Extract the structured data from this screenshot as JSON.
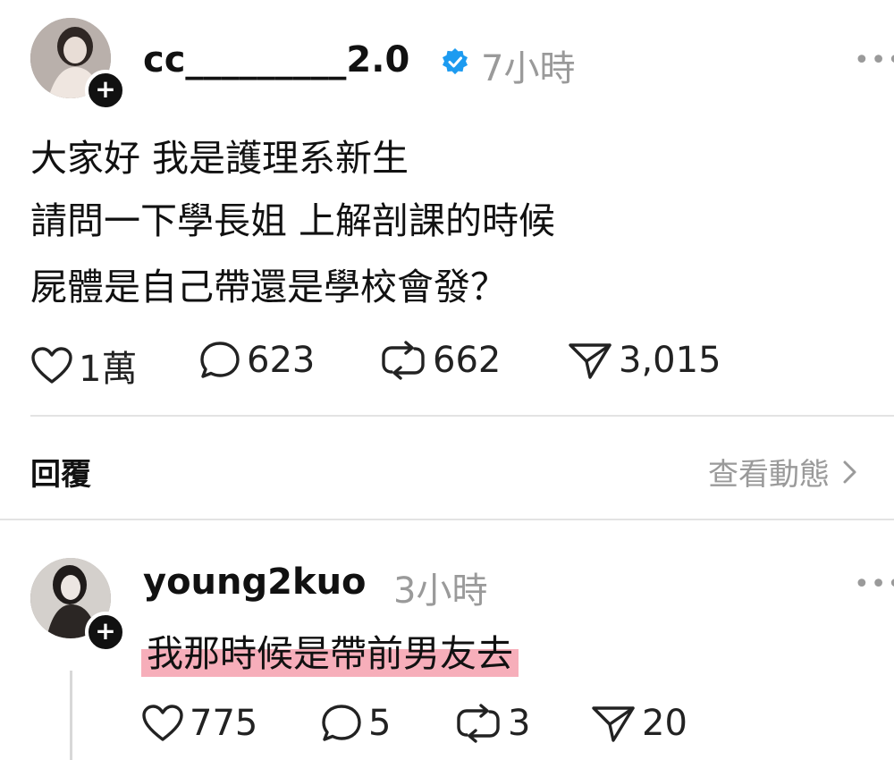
{
  "post": {
    "username": "cc_________2.0",
    "time": "7小時",
    "lines": [
      "大家好 我是護理系新生",
      "請問一下學長姐 上解剖課的時候",
      "屍體是自己帶還是學校會發？"
    ],
    "stats": {
      "likes": "1萬",
      "comments": "623",
      "reposts": "662",
      "shares": "3,015"
    }
  },
  "replies_header": {
    "label": "回覆",
    "activity_link": "查看動態"
  },
  "reply": {
    "username": "young2kuo",
    "time": "3小時",
    "text": "我那時候是帶前男友去",
    "stats": {
      "likes": "775",
      "comments": "5",
      "reposts": "3",
      "shares": "20"
    }
  },
  "colors": {
    "verified": "#1d9bf0",
    "highlight": "#f1788c",
    "muted": "#9a9a9a"
  },
  "icons": {
    "more": "more-icon",
    "verified": "verified-badge-icon",
    "like": "heart-icon",
    "comment": "comment-icon",
    "repost": "repost-icon",
    "share": "send-icon",
    "chevron": "chevron-right-icon",
    "follow": "plus-icon"
  }
}
